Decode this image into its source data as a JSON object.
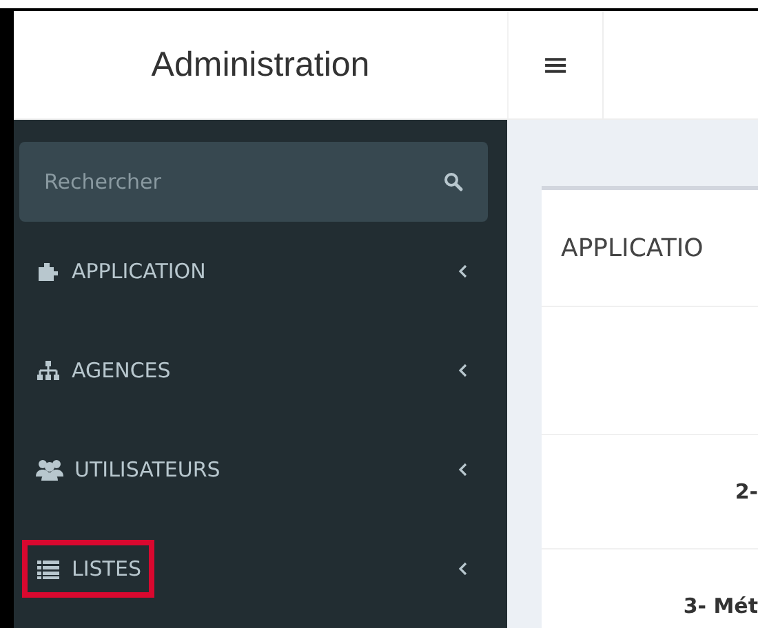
{
  "header": {
    "title": "Administration",
    "menu_toggle": "≡"
  },
  "sidebar": {
    "search": {
      "placeholder": "Rechercher"
    },
    "items": [
      {
        "label": "APPLICATION",
        "kind": "puzzle",
        "highlighted": false
      },
      {
        "label": "AGENCES",
        "kind": "sitemap",
        "highlighted": false
      },
      {
        "label": "UTILISATEURS",
        "kind": "users",
        "highlighted": false
      },
      {
        "label": "LISTES",
        "kind": "list",
        "highlighted": true
      }
    ]
  },
  "card": {
    "title": "APPLICATIO",
    "rows": [
      "2-",
      "3- Mét"
    ]
  }
}
